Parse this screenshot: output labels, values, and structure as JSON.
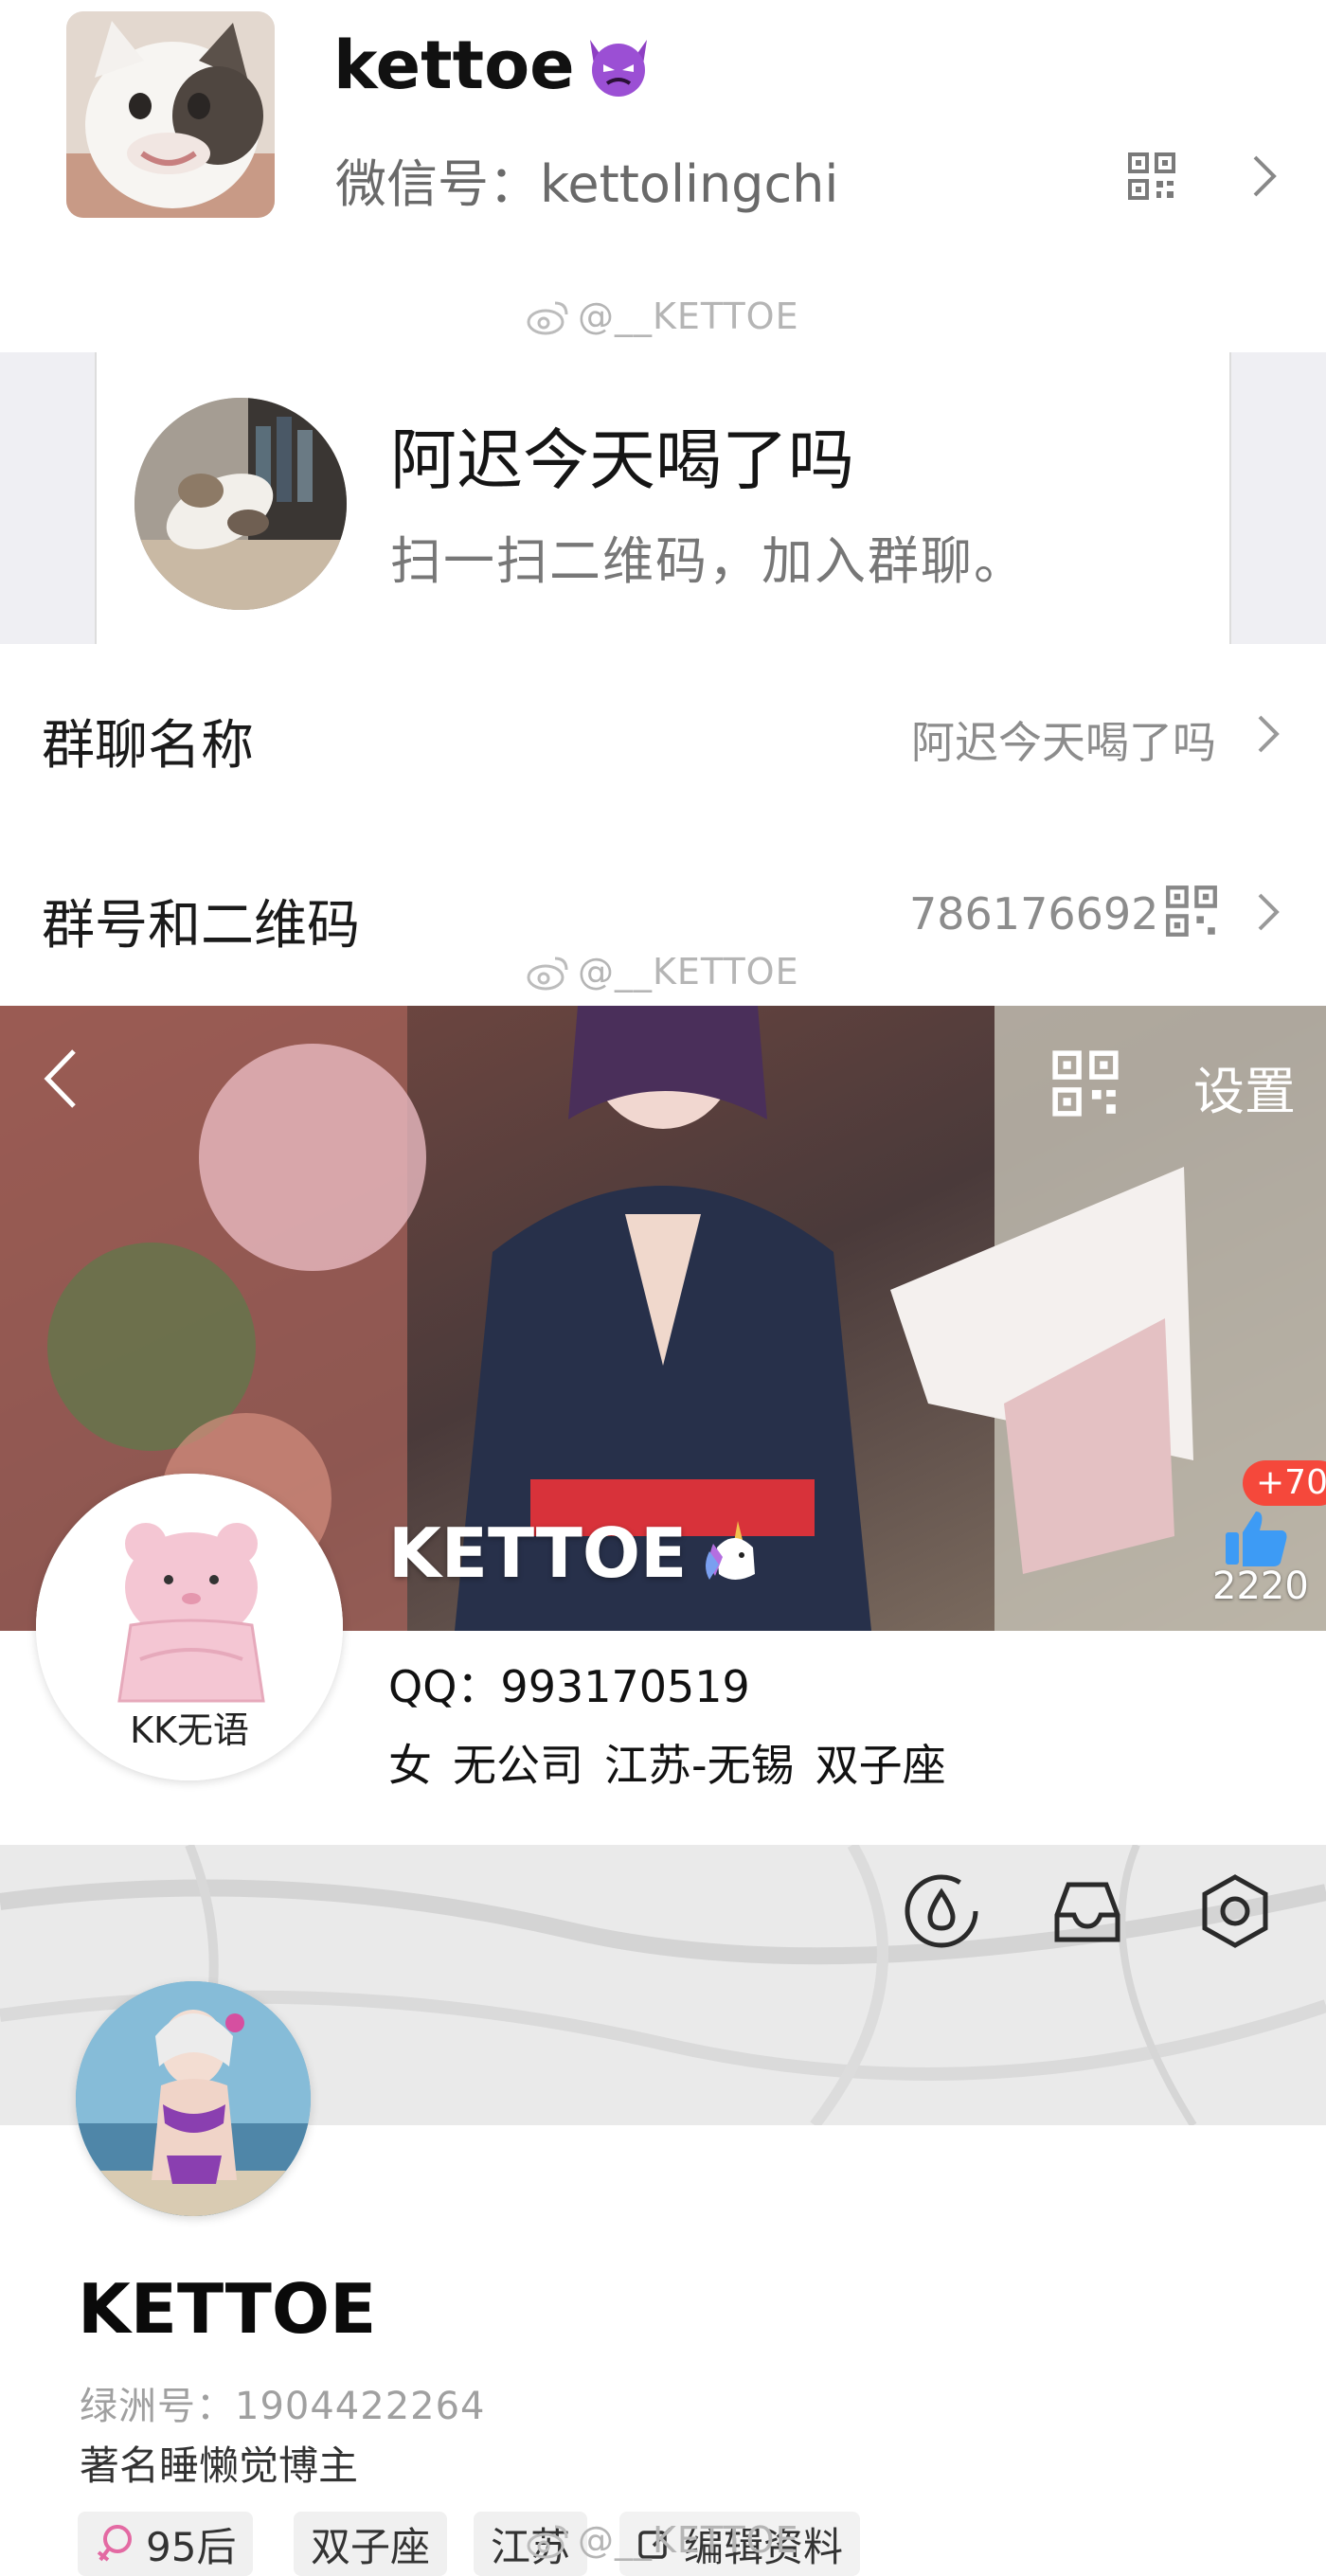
{
  "wechat_profile": {
    "name": "kettoe",
    "wechat_id_label": "微信号：",
    "wechat_id": "kettolingchi"
  },
  "watermark": {
    "text": "@__KETTOE"
  },
  "group_card": {
    "title": "阿迟今天喝了吗",
    "subtitle": "扫一扫二维码，加入群聊。"
  },
  "group_rows": [
    {
      "label": "群聊名称",
      "value": "阿迟今天喝了吗"
    },
    {
      "label": "群号和二维码",
      "value": "786176692"
    }
  ],
  "qq_profile": {
    "settings_label": "设置",
    "avatar_caption": "KK无语",
    "nickname": "KETTOE",
    "qq_label": "QQ：",
    "qq_number": "993170519",
    "info": [
      "女",
      "无公司",
      "江苏-无锡",
      "双子座"
    ],
    "like_badge": "+70",
    "like_count": "2220"
  },
  "oasis_profile": {
    "name": "KETTOE",
    "id_label": "绿洲号：",
    "id": "1904422264",
    "bio": "著名睡懒觉博主",
    "tags": [
      "95后",
      "双子座",
      "江苏"
    ],
    "edit_button": "编辑资料"
  },
  "colors": {
    "accent_red": "#f5483b",
    "like_blue": "#3d9bf5",
    "group_bg": "#efeff3",
    "muted_text": "#8c8c8c"
  },
  "icons": [
    "devil-emoji-icon",
    "qr-code-icon",
    "chevron-right-icon",
    "weibo-icon",
    "back-arrow-icon",
    "unicorn-emoji-icon",
    "thumbs-up-icon",
    "water-drop-icon",
    "inbox-icon",
    "settings-hexagon-icon",
    "female-icon",
    "edit-icon"
  ]
}
